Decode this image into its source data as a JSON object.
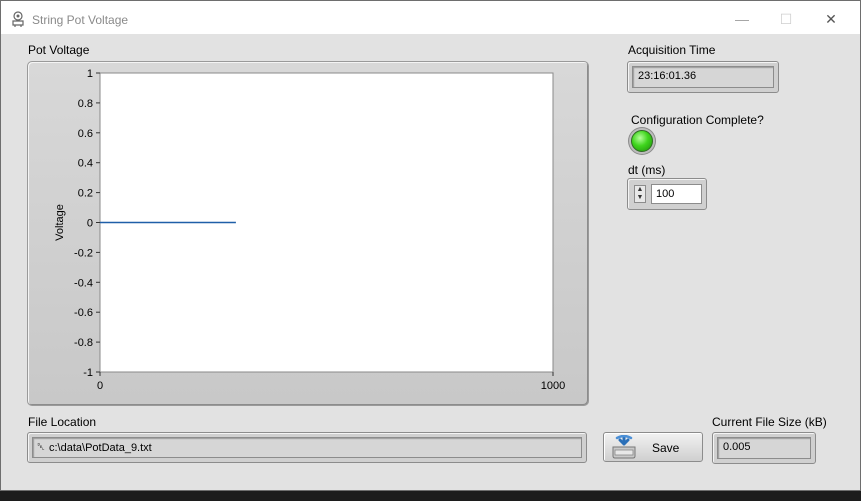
{
  "window": {
    "title": "String Pot Voltage",
    "minimize_glyph": "—",
    "maximize_glyph": "☐",
    "close_glyph": "✕"
  },
  "graph": {
    "label": "Pot Voltage"
  },
  "acquisition_time": {
    "label": "Acquisition Time",
    "value": "23:16:01.36"
  },
  "config": {
    "label": "Configuration Complete?",
    "led_state": "on",
    "led_color": "#3fd51d"
  },
  "dt": {
    "label": "dt (ms)",
    "value": "100"
  },
  "file_location": {
    "label": "File Location",
    "path_icon": "path-icon",
    "path_glyph": "␡",
    "value": "c:\\data\\PotData_9.txt"
  },
  "save": {
    "label": "Save",
    "icon": "save-disk-icon"
  },
  "file_size": {
    "label": "Current File Size (kB)",
    "value": "0.005"
  },
  "chart_data": {
    "type": "line",
    "ylabel": "Voltage",
    "xlabel": "",
    "xlim": [
      0,
      1000
    ],
    "ylim": [
      -1,
      1
    ],
    "x_ticks": [
      "0",
      "1000"
    ],
    "y_ticks": [
      "1",
      "0.8",
      "0.6",
      "0.4",
      "0.2",
      "0",
      "-0.2",
      "-0.4",
      "-0.6",
      "-0.8",
      "-1"
    ],
    "grid": false,
    "series": [
      {
        "x": [
          0,
          300
        ],
        "y": [
          0,
          0
        ],
        "color": "#1f5fa8"
      }
    ]
  }
}
